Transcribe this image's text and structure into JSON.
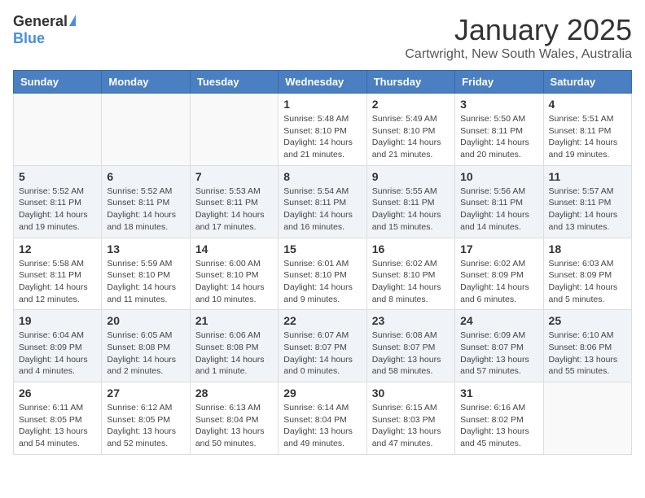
{
  "header": {
    "logo_general": "General",
    "logo_blue": "Blue",
    "month_title": "January 2025",
    "subtitle": "Cartwright, New South Wales, Australia"
  },
  "weekdays": [
    "Sunday",
    "Monday",
    "Tuesday",
    "Wednesday",
    "Thursday",
    "Friday",
    "Saturday"
  ],
  "weeks": [
    [
      {
        "day": "",
        "info": ""
      },
      {
        "day": "",
        "info": ""
      },
      {
        "day": "",
        "info": ""
      },
      {
        "day": "1",
        "info": "Sunrise: 5:48 AM\nSunset: 8:10 PM\nDaylight: 14 hours and 21 minutes."
      },
      {
        "day": "2",
        "info": "Sunrise: 5:49 AM\nSunset: 8:10 PM\nDaylight: 14 hours and 21 minutes."
      },
      {
        "day": "3",
        "info": "Sunrise: 5:50 AM\nSunset: 8:11 PM\nDaylight: 14 hours and 20 minutes."
      },
      {
        "day": "4",
        "info": "Sunrise: 5:51 AM\nSunset: 8:11 PM\nDaylight: 14 hours and 19 minutes."
      }
    ],
    [
      {
        "day": "5",
        "info": "Sunrise: 5:52 AM\nSunset: 8:11 PM\nDaylight: 14 hours and 19 minutes."
      },
      {
        "day": "6",
        "info": "Sunrise: 5:52 AM\nSunset: 8:11 PM\nDaylight: 14 hours and 18 minutes."
      },
      {
        "day": "7",
        "info": "Sunrise: 5:53 AM\nSunset: 8:11 PM\nDaylight: 14 hours and 17 minutes."
      },
      {
        "day": "8",
        "info": "Sunrise: 5:54 AM\nSunset: 8:11 PM\nDaylight: 14 hours and 16 minutes."
      },
      {
        "day": "9",
        "info": "Sunrise: 5:55 AM\nSunset: 8:11 PM\nDaylight: 14 hours and 15 minutes."
      },
      {
        "day": "10",
        "info": "Sunrise: 5:56 AM\nSunset: 8:11 PM\nDaylight: 14 hours and 14 minutes."
      },
      {
        "day": "11",
        "info": "Sunrise: 5:57 AM\nSunset: 8:11 PM\nDaylight: 14 hours and 13 minutes."
      }
    ],
    [
      {
        "day": "12",
        "info": "Sunrise: 5:58 AM\nSunset: 8:11 PM\nDaylight: 14 hours and 12 minutes."
      },
      {
        "day": "13",
        "info": "Sunrise: 5:59 AM\nSunset: 8:10 PM\nDaylight: 14 hours and 11 minutes."
      },
      {
        "day": "14",
        "info": "Sunrise: 6:00 AM\nSunset: 8:10 PM\nDaylight: 14 hours and 10 minutes."
      },
      {
        "day": "15",
        "info": "Sunrise: 6:01 AM\nSunset: 8:10 PM\nDaylight: 14 hours and 9 minutes."
      },
      {
        "day": "16",
        "info": "Sunrise: 6:02 AM\nSunset: 8:10 PM\nDaylight: 14 hours and 8 minutes."
      },
      {
        "day": "17",
        "info": "Sunrise: 6:02 AM\nSunset: 8:09 PM\nDaylight: 14 hours and 6 minutes."
      },
      {
        "day": "18",
        "info": "Sunrise: 6:03 AM\nSunset: 8:09 PM\nDaylight: 14 hours and 5 minutes."
      }
    ],
    [
      {
        "day": "19",
        "info": "Sunrise: 6:04 AM\nSunset: 8:09 PM\nDaylight: 14 hours and 4 minutes."
      },
      {
        "day": "20",
        "info": "Sunrise: 6:05 AM\nSunset: 8:08 PM\nDaylight: 14 hours and 2 minutes."
      },
      {
        "day": "21",
        "info": "Sunrise: 6:06 AM\nSunset: 8:08 PM\nDaylight: 14 hours and 1 minute."
      },
      {
        "day": "22",
        "info": "Sunrise: 6:07 AM\nSunset: 8:07 PM\nDaylight: 14 hours and 0 minutes."
      },
      {
        "day": "23",
        "info": "Sunrise: 6:08 AM\nSunset: 8:07 PM\nDaylight: 13 hours and 58 minutes."
      },
      {
        "day": "24",
        "info": "Sunrise: 6:09 AM\nSunset: 8:07 PM\nDaylight: 13 hours and 57 minutes."
      },
      {
        "day": "25",
        "info": "Sunrise: 6:10 AM\nSunset: 8:06 PM\nDaylight: 13 hours and 55 minutes."
      }
    ],
    [
      {
        "day": "26",
        "info": "Sunrise: 6:11 AM\nSunset: 8:05 PM\nDaylight: 13 hours and 54 minutes."
      },
      {
        "day": "27",
        "info": "Sunrise: 6:12 AM\nSunset: 8:05 PM\nDaylight: 13 hours and 52 minutes."
      },
      {
        "day": "28",
        "info": "Sunrise: 6:13 AM\nSunset: 8:04 PM\nDaylight: 13 hours and 50 minutes."
      },
      {
        "day": "29",
        "info": "Sunrise: 6:14 AM\nSunset: 8:04 PM\nDaylight: 13 hours and 49 minutes."
      },
      {
        "day": "30",
        "info": "Sunrise: 6:15 AM\nSunset: 8:03 PM\nDaylight: 13 hours and 47 minutes."
      },
      {
        "day": "31",
        "info": "Sunrise: 6:16 AM\nSunset: 8:02 PM\nDaylight: 13 hours and 45 minutes."
      },
      {
        "day": "",
        "info": ""
      }
    ]
  ]
}
